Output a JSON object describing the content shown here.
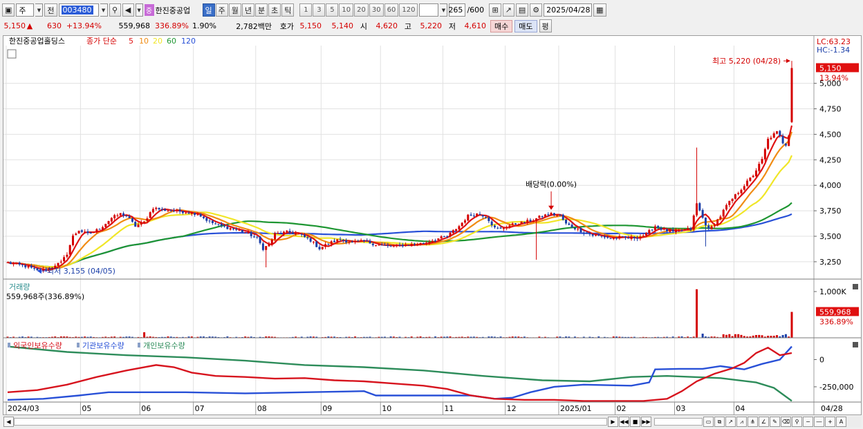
{
  "toolbar": {
    "period_select": "주",
    "prev_label": "전",
    "code": "003480",
    "stock_name": "한진중공업",
    "stock_badge": "중",
    "periods": [
      "일",
      "주",
      "월",
      "년",
      "분",
      "초",
      "틱"
    ],
    "active_period": "일",
    "intervals": [
      "1",
      "3",
      "5",
      "10",
      "20",
      "30",
      "60",
      "120"
    ],
    "count": "265",
    "count_total": "/600",
    "date": "2025/04/28"
  },
  "quote": {
    "price": "5,150",
    "change": "630",
    "change_pct": "+13.94%",
    "volume": "559,968",
    "vol_ratio": "336.89%",
    "turnover": "1.90%",
    "amount": "2,782백만",
    "ask_label": "호가",
    "ask": "5,150",
    "bid": "5,140",
    "open_label": "시",
    "open": "4,620",
    "high_label": "고",
    "high": "5,220",
    "low_label": "저",
    "low": "4,610",
    "buy_label": "매수",
    "sell_label": "매도",
    "avg_label": "평"
  },
  "legend": {
    "name": "한진중공업홀딩스",
    "desc": "종가 단순",
    "ma": [
      "5",
      "10",
      "20",
      "60",
      "120"
    ],
    "lc": "LC:63.23",
    "hc": "HC:-1.34"
  },
  "annotations": {
    "high": "최고 5,220 (04/28)",
    "low": "최저 3,155 (04/05)",
    "dividend": "배당락(0.00%)",
    "last_price": "5,150",
    "last_pct": "13.94%"
  },
  "volume_panel": {
    "title": "거래량",
    "summary": "559,968주(336.89%)",
    "last_label": "559,968",
    "last_pct": "336.89%"
  },
  "holdings_panel": {
    "titles": [
      "외국인보유수량",
      "기관보유수량",
      "개인보유수량"
    ]
  },
  "colors": {
    "ma5": "#e01414",
    "ma10": "#f08c14",
    "ma20": "#f0e628",
    "ma60": "#1e9632",
    "ma120": "#2850d7",
    "up": "#d40000",
    "down": "#1a3ea8",
    "foreign": "#d7141e",
    "institution": "#2850d7",
    "individual": "#2d8c5a"
  },
  "chart_data": {
    "type": "candlestick",
    "price_axis": {
      "ticks": [
        3250,
        3500,
        3750,
        4000,
        4250,
        4500,
        4750,
        5000
      ],
      "range": [
        3080,
        5370
      ]
    },
    "x_axis": {
      "labels": [
        "2024/03",
        "05",
        "06",
        "07",
        "08",
        "09",
        "10",
        "11",
        "12",
        "2025/01",
        "02",
        "03",
        "04"
      ],
      "last_label": "04/28"
    },
    "price_anchors": [
      [
        0,
        3240
      ],
      [
        7,
        3200
      ],
      [
        10,
        3160
      ],
      [
        14,
        3180
      ],
      [
        16,
        3220
      ],
      [
        18,
        3240
      ],
      [
        20,
        3330
      ],
      [
        22,
        3500
      ],
      [
        24,
        3560
      ],
      [
        27,
        3520
      ],
      [
        30,
        3560
      ],
      [
        32,
        3600
      ],
      [
        35,
        3680
      ],
      [
        38,
        3720
      ],
      [
        40,
        3700
      ],
      [
        43,
        3600
      ],
      [
        46,
        3640
      ],
      [
        49,
        3780
      ],
      [
        52,
        3760
      ],
      [
        56,
        3750
      ],
      [
        60,
        3740
      ],
      [
        64,
        3720
      ],
      [
        68,
        3640
      ],
      [
        72,
        3600
      ],
      [
        76,
        3570
      ],
      [
        80,
        3540
      ],
      [
        84,
        3480
      ],
      [
        86,
        3380
      ],
      [
        88,
        3420
      ],
      [
        90,
        3520
      ],
      [
        94,
        3540
      ],
      [
        98,
        3520
      ],
      [
        102,
        3460
      ],
      [
        105,
        3380
      ],
      [
        108,
        3430
      ],
      [
        112,
        3470
      ],
      [
        116,
        3440
      ],
      [
        120,
        3450
      ],
      [
        124,
        3420
      ],
      [
        128,
        3400
      ],
      [
        132,
        3410
      ],
      [
        136,
        3420
      ],
      [
        140,
        3430
      ],
      [
        144,
        3470
      ],
      [
        148,
        3500
      ],
      [
        152,
        3600
      ],
      [
        155,
        3700
      ],
      [
        158,
        3720
      ],
      [
        161,
        3700
      ],
      [
        164,
        3580
      ],
      [
        166,
        3570
      ],
      [
        168,
        3600
      ],
      [
        171,
        3620
      ],
      [
        174,
        3640
      ],
      [
        177,
        3660
      ],
      [
        180,
        3700
      ],
      [
        183,
        3720
      ],
      [
        186,
        3700
      ],
      [
        188,
        3620
      ],
      [
        191,
        3580
      ],
      [
        194,
        3540
      ],
      [
        197,
        3510
      ],
      [
        200,
        3500
      ],
      [
        203,
        3480
      ],
      [
        206,
        3490
      ],
      [
        209,
        3480
      ],
      [
        212,
        3490
      ],
      [
        215,
        3520
      ],
      [
        218,
        3600
      ],
      [
        221,
        3560
      ],
      [
        224,
        3540
      ],
      [
        227,
        3560
      ],
      [
        230,
        3570
      ],
      [
        232,
        3820
      ],
      [
        234,
        3680
      ],
      [
        236,
        3560
      ],
      [
        238,
        3620
      ],
      [
        240,
        3700
      ],
      [
        242,
        3800
      ],
      [
        245,
        3900
      ],
      [
        248,
        4000
      ],
      [
        251,
        4100
      ],
      [
        254,
        4250
      ],
      [
        256,
        4450
      ],
      [
        258,
        4500
      ],
      [
        259,
        4520
      ],
      [
        260,
        4480
      ],
      [
        261,
        4420
      ],
      [
        262,
        4400
      ],
      [
        263,
        4500
      ],
      [
        264,
        5150
      ]
    ],
    "spikes": [
      {
        "index": 87,
        "low": 3195
      },
      {
        "index": 232,
        "high": 4370
      },
      {
        "index": 235,
        "low": 3400
      },
      {
        "index": 178,
        "low": 3270
      },
      {
        "index": 264,
        "high": 5220,
        "low": 4610,
        "open": 4620
      }
    ],
    "dividend_index": 183,
    "volume": {
      "ticks": [
        "1,000K"
      ],
      "max": 1150000,
      "last": 559968,
      "spike_index": 232,
      "spike_value": 1050000
    },
    "holdings": {
      "ticks": [
        "0",
        "-250,000"
      ],
      "range": [
        -390000,
        130000
      ],
      "foreign": [
        [
          0,
          -300000
        ],
        [
          10,
          -280000
        ],
        [
          20,
          -230000
        ],
        [
          30,
          -160000
        ],
        [
          40,
          -100000
        ],
        [
          50,
          -50000
        ],
        [
          56,
          -70000
        ],
        [
          62,
          -120000
        ],
        [
          70,
          -150000
        ],
        [
          80,
          -160000
        ],
        [
          90,
          -175000
        ],
        [
          100,
          -170000
        ],
        [
          110,
          -190000
        ],
        [
          120,
          -200000
        ],
        [
          130,
          -220000
        ],
        [
          140,
          -240000
        ],
        [
          148,
          -270000
        ],
        [
          156,
          -330000
        ],
        [
          164,
          -360000
        ],
        [
          174,
          -370000
        ],
        [
          184,
          -370000
        ],
        [
          194,
          -380000
        ],
        [
          204,
          -380000
        ],
        [
          214,
          -380000
        ],
        [
          222,
          -360000
        ],
        [
          227,
          -290000
        ],
        [
          232,
          -200000
        ],
        [
          238,
          -130000
        ],
        [
          244,
          -80000
        ],
        [
          248,
          -30000
        ],
        [
          252,
          60000
        ],
        [
          256,
          110000
        ],
        [
          260,
          40000
        ],
        [
          264,
          60000
        ]
      ],
      "institution": [
        [
          0,
          -370000
        ],
        [
          12,
          -360000
        ],
        [
          24,
          -330000
        ],
        [
          34,
          -300000
        ],
        [
          60,
          -300000
        ],
        [
          80,
          -310000
        ],
        [
          100,
          -300000
        ],
        [
          120,
          -290000
        ],
        [
          124,
          -330000
        ],
        [
          140,
          -330000
        ],
        [
          156,
          -330000
        ],
        [
          164,
          -360000
        ],
        [
          170,
          -350000
        ],
        [
          176,
          -300000
        ],
        [
          184,
          -250000
        ],
        [
          194,
          -230000
        ],
        [
          210,
          -240000
        ],
        [
          216,
          -210000
        ],
        [
          218,
          -90000
        ],
        [
          226,
          -85000
        ],
        [
          234,
          -85000
        ],
        [
          240,
          -60000
        ],
        [
          248,
          -90000
        ],
        [
          254,
          -40000
        ],
        [
          260,
          0
        ],
        [
          264,
          120000
        ]
      ],
      "individual": [
        [
          0,
          120000
        ],
        [
          20,
          70000
        ],
        [
          40,
          40000
        ],
        [
          60,
          20000
        ],
        [
          80,
          -10000
        ],
        [
          100,
          -50000
        ],
        [
          120,
          -70000
        ],
        [
          140,
          -100000
        ],
        [
          160,
          -150000
        ],
        [
          180,
          -190000
        ],
        [
          196,
          -200000
        ],
        [
          210,
          -160000
        ],
        [
          222,
          -150000
        ],
        [
          240,
          -170000
        ],
        [
          252,
          -210000
        ],
        [
          258,
          -260000
        ],
        [
          264,
          -380000
        ]
      ]
    }
  }
}
